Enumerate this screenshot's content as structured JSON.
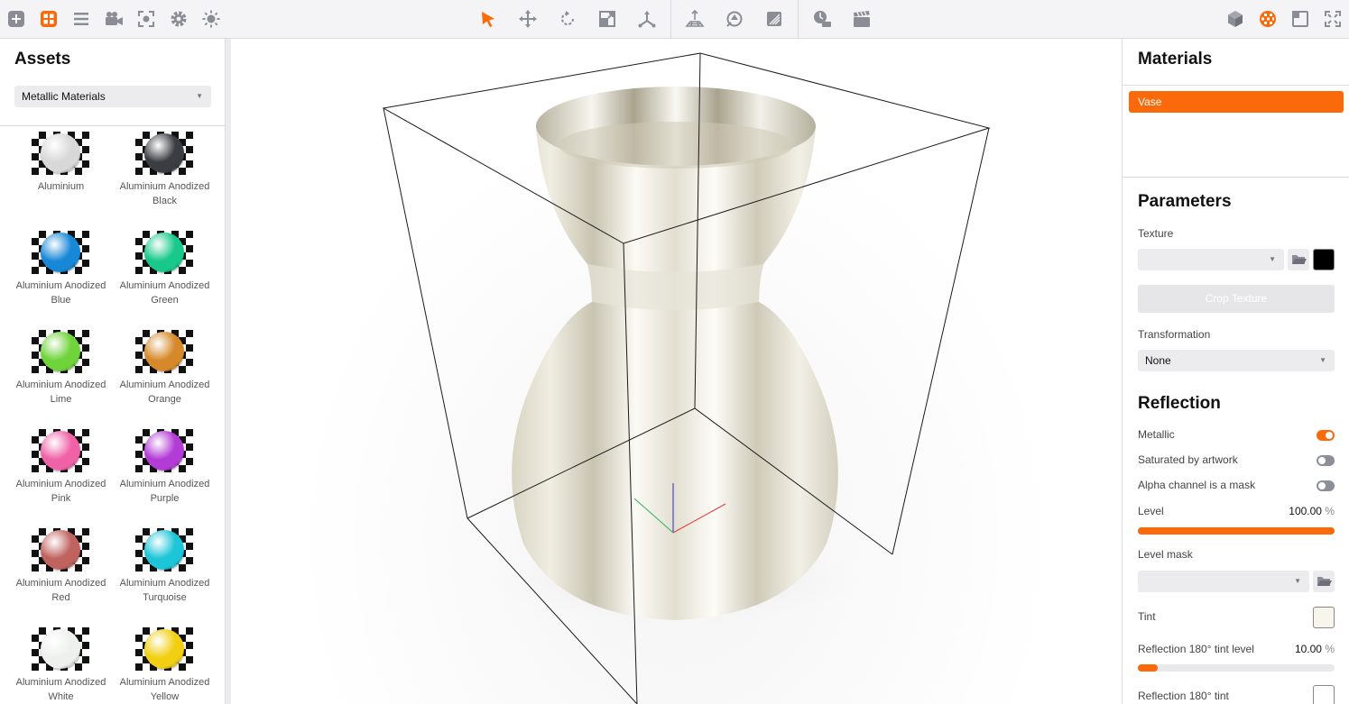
{
  "toolbar": {
    "left_tools": [
      "add-icon",
      "assets-grid-icon",
      "list-icon",
      "camera-icon",
      "focus-icon",
      "gear-icon",
      "light-icon"
    ],
    "center_tools": [
      "select-arrow-icon",
      "move-icon",
      "rotate-icon",
      "scale-icon",
      "pivot-icon",
      "floor-icon",
      "focus-target-icon",
      "render-region-icon",
      "time-of-day-icon",
      "clapper-icon"
    ],
    "right_tools": [
      "cube-icon",
      "material-sphere-icon",
      "panel-layout-icon",
      "fullscreen-icon"
    ],
    "accent_color": "#fa6a0a"
  },
  "assets": {
    "title": "Assets",
    "category": "Metallic Materials",
    "items": [
      {
        "line1": "Aluminium",
        "line2": "",
        "color": "#d8d8d8"
      },
      {
        "line1": "Aluminium Anodized",
        "line2": "Black",
        "color": "#3a3d42"
      },
      {
        "line1": "Aluminium Anodized",
        "line2": "Blue",
        "color": "#1787d8"
      },
      {
        "line1": "Aluminium Anodized",
        "line2": "Green",
        "color": "#17c98a"
      },
      {
        "line1": "Aluminium Anodized",
        "line2": "Lime",
        "color": "#6fd33a"
      },
      {
        "line1": "Aluminium Anodized",
        "line2": "Orange",
        "color": "#d6892a"
      },
      {
        "line1": "Aluminium Anodized",
        "line2": "Pink",
        "color": "#ef62a8"
      },
      {
        "line1": "Aluminium Anodized",
        "line2": "Purple",
        "color": "#b33bd6"
      },
      {
        "line1": "Aluminium Anodized",
        "line2": "Red",
        "color": "#c0625e"
      },
      {
        "line1": "Aluminium Anodized",
        "line2": "Turquoise",
        "color": "#1cc5d8"
      },
      {
        "line1": "Aluminium Anodized",
        "line2": "White",
        "color": "#eef0ee"
      },
      {
        "line1": "Aluminium Anodized",
        "line2": "Yellow",
        "color": "#f2cf12"
      }
    ]
  },
  "materials": {
    "title": "Materials",
    "items": [
      "Vase"
    ]
  },
  "parameters": {
    "title": "Parameters",
    "texture_label": "Texture",
    "texture_value": "",
    "texture_color": "#000000",
    "crop_texture_label": "Crop Texture",
    "transformation_label": "Transformation",
    "transformation_value": "None"
  },
  "reflection": {
    "title": "Reflection",
    "metallic_label": "Metallic",
    "metallic_on": true,
    "saturated_label": "Saturated by artwork",
    "saturated_on": false,
    "alpha_mask_label": "Alpha channel is a mask",
    "alpha_mask_on": false,
    "level_label": "Level",
    "level_value": "100.00",
    "level_percent": 100,
    "level_mask_label": "Level mask",
    "level_mask_value": "",
    "tint_label": "Tint",
    "tint_color": "#f8f5ec",
    "tint180_level_label": "Reflection 180° tint level",
    "tint180_level_value": "10.00",
    "tint180_level_percent": 10,
    "tint180_label": "Reflection 180° tint",
    "tint180_color": "#ffffff",
    "unit": "%"
  }
}
